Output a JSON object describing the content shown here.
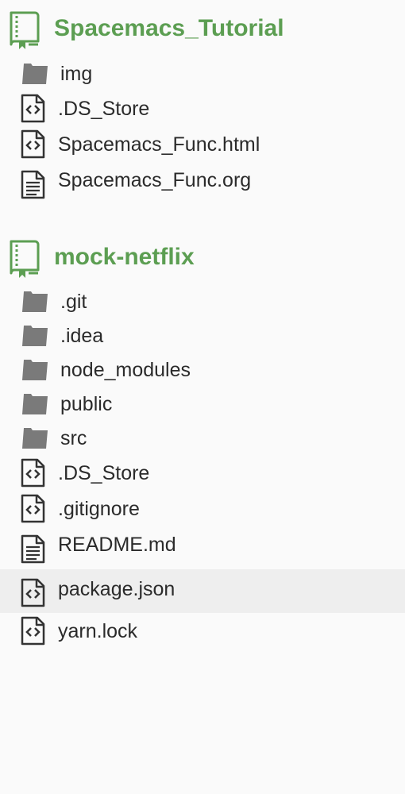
{
  "colors": {
    "repo_green": "#5c9e52",
    "folder_gray": "#7a7a7a",
    "file_dark": "#333333",
    "selected_row": "#eeeeee"
  },
  "repos": [
    {
      "name": "Spacemacs_Tutorial",
      "icon": "repo-book-icon",
      "items": [
        {
          "label": "img",
          "type": "folder",
          "icon": "folder-icon"
        },
        {
          "label": ".DS_Store",
          "type": "code-file",
          "icon": "code-file-icon"
        },
        {
          "label": "Spacemacs_Func.html",
          "type": "code-file",
          "icon": "code-file-icon"
        },
        {
          "label": "Spacemacs_Func.org",
          "type": "text-file",
          "icon": "text-file-icon"
        }
      ]
    },
    {
      "name": "mock-netflix",
      "icon": "repo-book-icon",
      "items": [
        {
          "label": ".git",
          "type": "folder",
          "icon": "folder-icon"
        },
        {
          "label": ".idea",
          "type": "folder",
          "icon": "folder-icon"
        },
        {
          "label": "node_modules",
          "type": "folder",
          "icon": "folder-icon"
        },
        {
          "label": "public",
          "type": "folder",
          "icon": "folder-icon"
        },
        {
          "label": "src",
          "type": "folder",
          "icon": "folder-icon"
        },
        {
          "label": ".DS_Store",
          "type": "code-file",
          "icon": "code-file-icon"
        },
        {
          "label": ".gitignore",
          "type": "code-file",
          "icon": "code-file-icon"
        },
        {
          "label": "README.md",
          "type": "text-file",
          "icon": "text-file-icon"
        },
        {
          "label": "package.json",
          "type": "code-file",
          "icon": "code-file-icon",
          "selected": true
        },
        {
          "label": "yarn.lock",
          "type": "code-file",
          "icon": "code-file-icon"
        }
      ]
    }
  ]
}
